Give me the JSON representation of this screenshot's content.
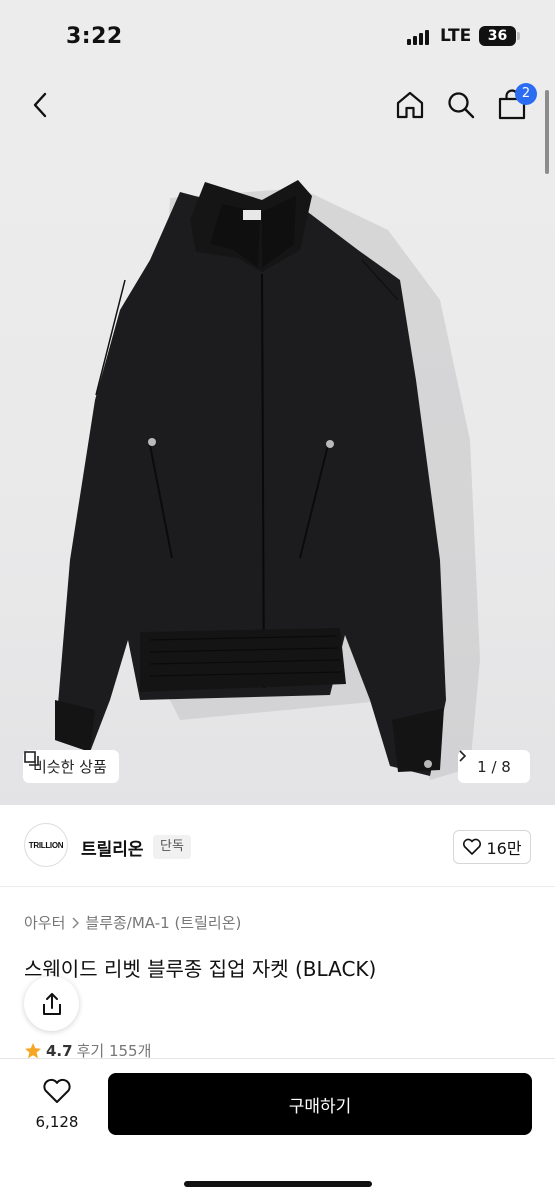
{
  "status_bar": {
    "time": "3:22",
    "network": "LTE",
    "battery": "36"
  },
  "nav": {
    "cart_count": "2"
  },
  "gallery": {
    "similar_label": "비슷한 상품",
    "counter": "1 / 8"
  },
  "brand": {
    "logo_text": "TRILLION",
    "name": "트릴리온",
    "badge": "단독",
    "likes": "16만"
  },
  "product": {
    "breadcrumb": [
      "아우터",
      "블루종/MA-1 (트릴리온)"
    ],
    "title": "스웨이드 리벳 블루종 집업 자켓 (BLACK)",
    "rating": "4.7",
    "review_text": "후기 155개"
  },
  "bottom_bar": {
    "wish_count": "6,128",
    "buy_label": "구매하기"
  },
  "colors": {
    "accent": "#2b6df2",
    "rating_star": "#f5a623",
    "buy_button": "#000000"
  },
  "icons": [
    "back-icon",
    "home-icon",
    "search-icon",
    "cart-icon",
    "similar-icon",
    "chevron-right-icon",
    "heart-icon",
    "share-icon",
    "star-icon"
  ]
}
